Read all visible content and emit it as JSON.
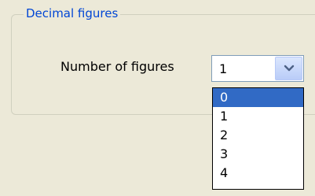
{
  "group": {
    "title": "Decimal figures"
  },
  "field": {
    "label": "Number of figures",
    "selected_value": "1"
  },
  "dropdown": {
    "options": [
      "0",
      "1",
      "2",
      "3",
      "4"
    ],
    "highlighted_option": "0"
  },
  "icons": {
    "dropdown_button": "chevron-down-icon"
  },
  "colors": {
    "legend_text": "#0046d5",
    "selection_background": "#316ac5",
    "selection_text": "#ffffff",
    "dialog_background": "#ece9d8"
  }
}
